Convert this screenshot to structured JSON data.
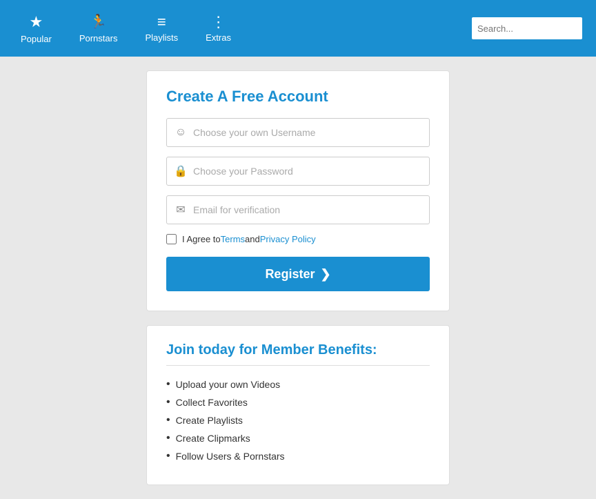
{
  "navbar": {
    "items": [
      {
        "id": "popular",
        "label": "Popular",
        "icon": "star"
      },
      {
        "id": "pornstars",
        "label": "Pornstars",
        "icon": "user"
      },
      {
        "id": "playlists",
        "label": "Playlists",
        "icon": "list"
      },
      {
        "id": "extras",
        "label": "Extras",
        "icon": "dots"
      }
    ],
    "search_placeholder": "Search..."
  },
  "register_card": {
    "title": "Create A Free Account",
    "username_placeholder": "Choose your own Username",
    "password_placeholder": "Choose your Password",
    "email_placeholder": "Email for verification",
    "agree_text": "I Agree to ",
    "terms_label": "Terms",
    "and_text": " and ",
    "privacy_label": "Privacy Policy",
    "register_label": "Register",
    "arrow": "❯"
  },
  "benefits_card": {
    "title": "Join today for Member Benefits:",
    "items": [
      "Upload your own Videos",
      "Collect Favorites",
      "Create Playlists",
      "Create Clipmarks",
      "Follow Users & Pornstars"
    ]
  }
}
